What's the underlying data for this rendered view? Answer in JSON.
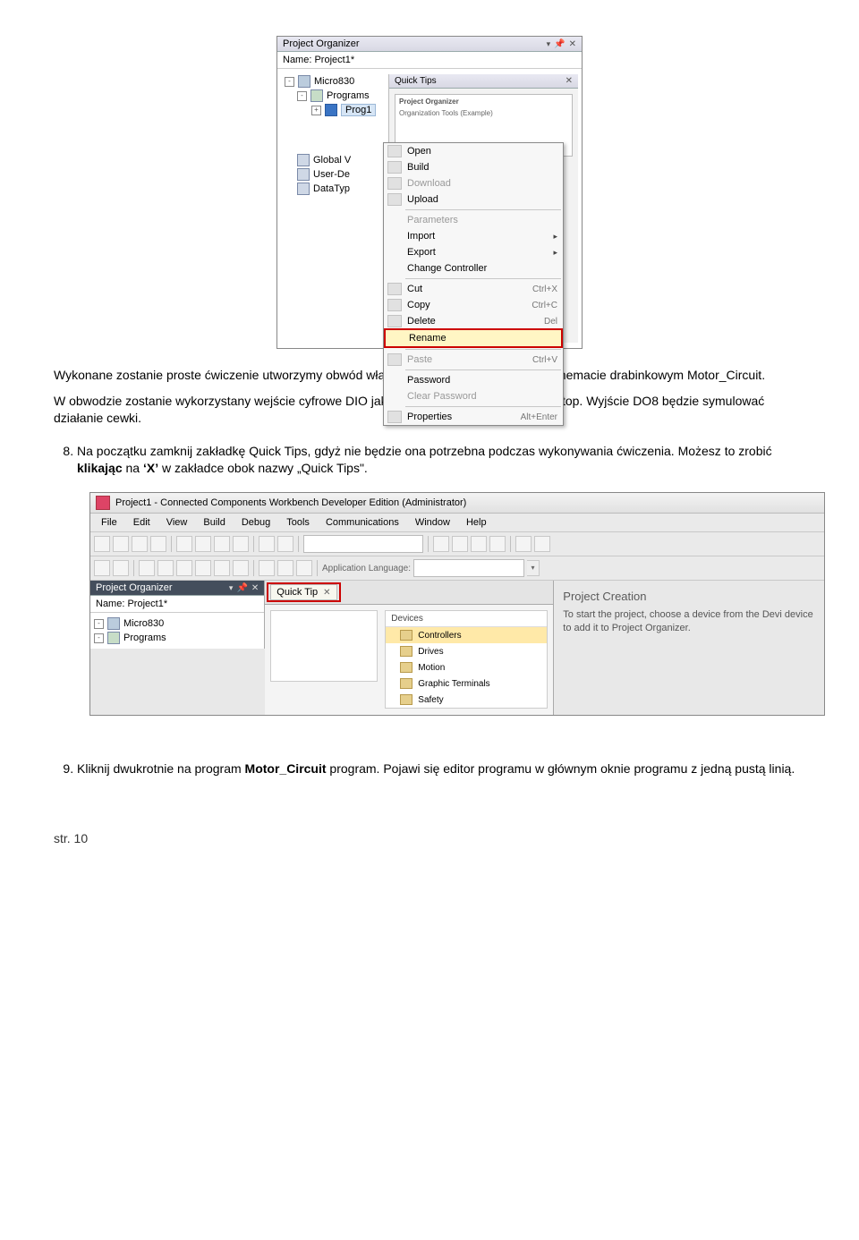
{
  "fig1": {
    "organizer_title": "Project Organizer",
    "name_label": "Name:",
    "name_value": "Project1*",
    "tree": {
      "root": "Micro830",
      "programs": "Programs",
      "prog_selected": "Prog1",
      "global": "Global V",
      "userdef": "User-De",
      "datatype": "DataTyp"
    },
    "quicktips": {
      "tab": "Quick Tips",
      "panel_title": "Project Organizer",
      "panel_rows": "Organization Tools (Example)"
    },
    "context_menu": [
      {
        "label": "Open",
        "icon": true,
        "kind": "item"
      },
      {
        "label": "Build",
        "icon": true,
        "kind": "item"
      },
      {
        "label": "Download",
        "icon": true,
        "kind": "item",
        "disabled": true
      },
      {
        "label": "Upload",
        "icon": true,
        "kind": "item"
      },
      {
        "kind": "sep"
      },
      {
        "label": "Parameters",
        "icon": false,
        "kind": "item",
        "disabled": true
      },
      {
        "label": "Import",
        "icon": false,
        "kind": "item",
        "submenu": true
      },
      {
        "label": "Export",
        "icon": false,
        "kind": "item",
        "submenu": true
      },
      {
        "label": "Change Controller",
        "icon": false,
        "kind": "item"
      },
      {
        "kind": "sep"
      },
      {
        "label": "Cut",
        "icon": true,
        "shortcut": "Ctrl+X",
        "kind": "item"
      },
      {
        "label": "Copy",
        "icon": true,
        "shortcut": "Ctrl+C",
        "kind": "item"
      },
      {
        "label": "Delete",
        "icon": true,
        "shortcut": "Del",
        "kind": "item"
      },
      {
        "label": "Rename",
        "icon": false,
        "kind": "highlight"
      },
      {
        "kind": "sep"
      },
      {
        "label": "Paste",
        "icon": true,
        "shortcut": "Ctrl+V",
        "kind": "item",
        "disabled": true
      },
      {
        "kind": "sep"
      },
      {
        "label": "Password",
        "icon": false,
        "kind": "item"
      },
      {
        "label": "Clear Password",
        "icon": false,
        "kind": "item",
        "disabled": true
      },
      {
        "kind": "sep"
      },
      {
        "label": "Properties",
        "icon": true,
        "shortcut": "Alt+Enter",
        "kind": "item"
      }
    ]
  },
  "para1_a": "Wykonane zostanie proste ćwiczenie utworzymy obwód włączania i wyłączania silnika w schemacie drabinkowym Motor_Circuit.",
  "para1_b": "W obwodzie zostanie wykorzystany wejście cyfrowe DIO jako przycisk Start oraz DI1 jako Stop. Wyjście  DO8 będzie symulować działanie cewki.",
  "step8_num": "8",
  "step8_a": "Na początku zamknij zakładkę Quick Tips, gdyż nie będzie ona potrzebna podczas wykonywania ćwiczenia. Możesz to zrobić ",
  "step8_bold": "klikając",
  "step8_b": " na ",
  "step8_x": "‘X’",
  "step8_c": " w zakładce obok nazwy „Quick Tips\".",
  "fig2": {
    "title": "Project1 - Connected Components Workbench Developer Edition (Administrator)",
    "menus": [
      "File",
      "Edit",
      "View",
      "Build",
      "Debug",
      "Tools",
      "Communications",
      "Window",
      "Help"
    ],
    "app_lang_label": "Application Language:",
    "organizer_title": "Project Organizer",
    "name_label": "Name:",
    "name_value": "Project1*",
    "tree_root": "Micro830",
    "tree_programs": "Programs",
    "qt_tab": "Quick Tip",
    "cat_header": "Devices",
    "cat_items": [
      "Controllers",
      "Drives",
      "Motion",
      "Graphic Terminals",
      "Safety"
    ],
    "pc_heading": "Project Creation",
    "pc_text": "To start the project, choose a device from the Devi device to add it to Project Organizer."
  },
  "step9_num": "9",
  "step9_a": "Kliknij dwukrotnie na program ",
  "step9_bold": "Motor_Circuit",
  "step9_b": " program. Pojawi się editor programu w głównym oknie programu z jedną pustą linią.",
  "page_number": "str. 10"
}
